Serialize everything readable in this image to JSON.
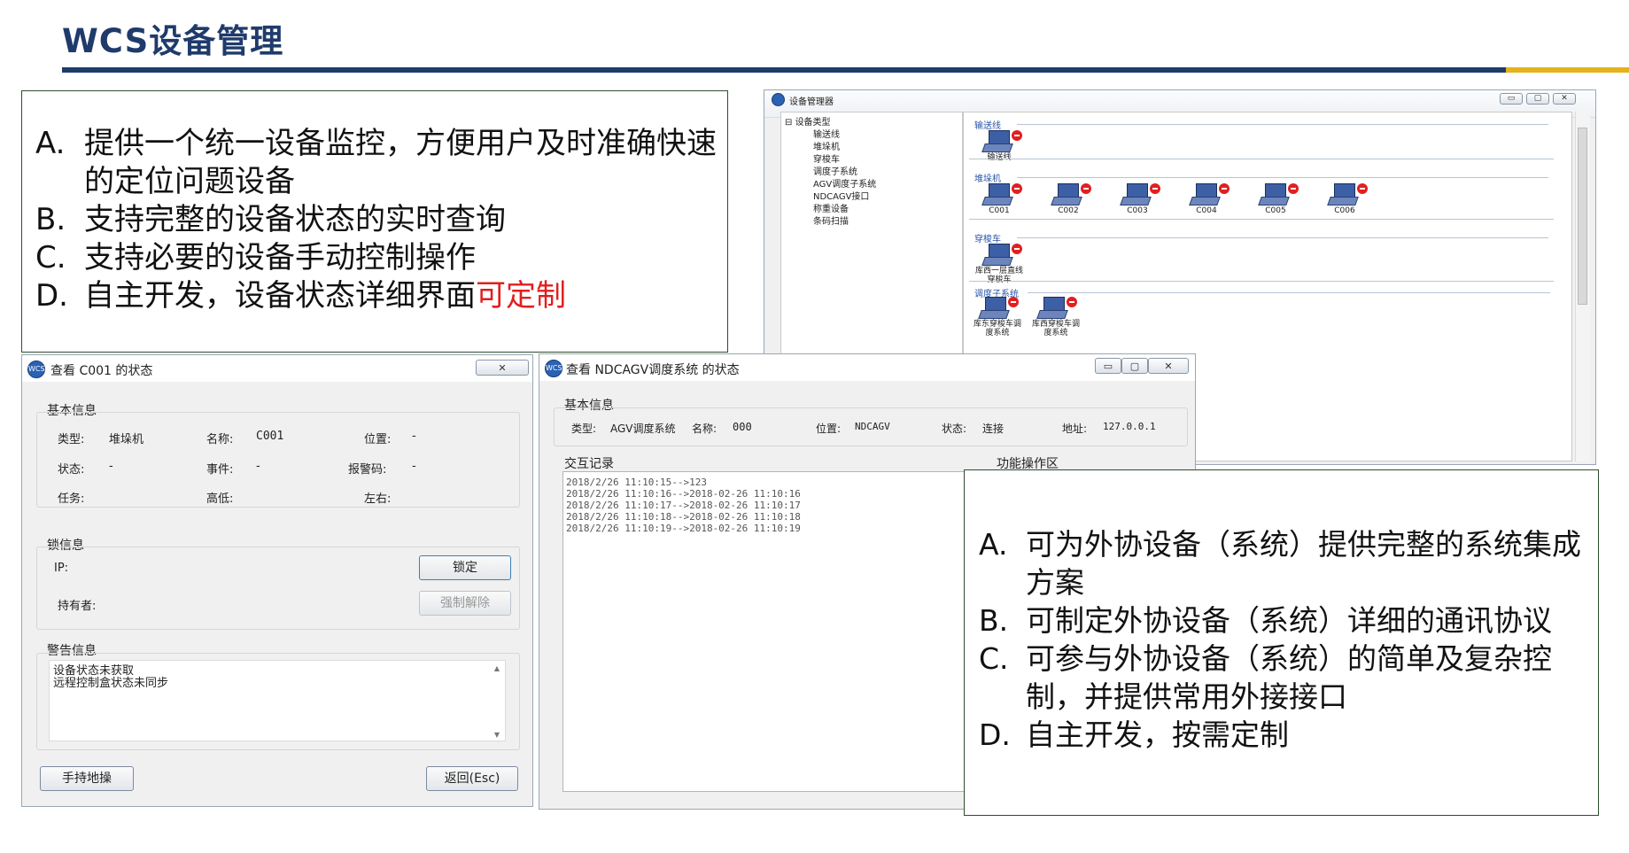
{
  "slide": {
    "title": "WCS设备管理",
    "colors": {
      "title": "#1f3b6b",
      "bar": "#1f3b6b",
      "accent": "#e3b21c",
      "highlight": "#e11e1e"
    }
  },
  "box1": {
    "items": [
      {
        "letter": "A.",
        "text": "提供一个统一设备监控，方便用户及时准确快速的定位问题设备"
      },
      {
        "letter": "B.",
        "text": "支持完整的设备状态的实时查询"
      },
      {
        "letter": "C.",
        "text": "支持必要的设备手动控制操作"
      },
      {
        "letter": "D.",
        "text": "自主开发，设备状态详细界面",
        "highlight": "可定制"
      }
    ]
  },
  "box2": {
    "items": [
      {
        "letter": "A.",
        "text": "可为外协设备（系统）提供完整的系统集成方案"
      },
      {
        "letter": "B.",
        "text": "可制定外协设备（系统）详细的通讯协议"
      },
      {
        "letter": "C.",
        "text": "可参与外协设备（系统）的简单及复杂控制，并提供常用外接接口"
      },
      {
        "letter": "D.",
        "text": "自主开发，按需定制"
      }
    ]
  },
  "devmgr": {
    "title": "设备管理器",
    "tree": {
      "root": "设备类型",
      "items": [
        "输送线",
        "堆垛机",
        "穿梭车",
        "调度子系统",
        "AGV调度子系统",
        "NDCAGV接口",
        "称重设备",
        "条码扫描"
      ]
    },
    "sections": [
      {
        "name": "输送线",
        "devices": [
          "输送线"
        ]
      },
      {
        "name": "堆垛机",
        "devices": [
          "C001",
          "C002",
          "C003",
          "C004",
          "C005",
          "C006"
        ]
      },
      {
        "name": "穿梭车",
        "devices": [
          "库西一层直线穿梭车"
        ]
      },
      {
        "name": "调度子系统",
        "devices": [
          "库东穿梭车调度系统",
          "库西穿梭车调度系统"
        ]
      }
    ]
  },
  "c001": {
    "title": "查看 C001 的状态",
    "basic": {
      "label": "基本信息",
      "type_label": "类型:",
      "type_value": "堆垛机",
      "name_label": "名称:",
      "name_value": "C001",
      "pos_label": "位置:",
      "pos_value": "-",
      "status_label": "状态:",
      "status_value": "-",
      "event_label": "事件:",
      "event_value": "-",
      "alarm_label": "报警码:",
      "alarm_value": "-",
      "task_label": "任务:",
      "height_label": "高低:",
      "lr_label": "左右:"
    },
    "lock": {
      "label": "锁信息",
      "ip_label": "IP:",
      "owner_label": "持有者:",
      "lock_button": "锁定",
      "force_unlock_button": "强制解除"
    },
    "warning": {
      "label": "警告信息",
      "lines": [
        "设备状态未获取",
        "远程控制盒状态未同步"
      ]
    },
    "handheld_button": "手持地操",
    "back_button": "返回(Esc)"
  },
  "agv": {
    "title": "查看 NDCAGV调度系统 的状态",
    "basic": {
      "label": "基本信息",
      "type_label": "类型:",
      "type_value": "AGV调度系统",
      "name_label": "名称:",
      "name_value": "000",
      "pos_label": "位置:",
      "pos_value": "NDCAGV",
      "status_label": "状态:",
      "status_value": "连接",
      "addr_label": "地址:",
      "addr_value": "127.0.0.1"
    },
    "log_label": "交互记录",
    "func_label": "功能操作区",
    "log": [
      "2018/2/26 11:10:15-->123",
      "2018/2/26 11:10:16-->2018-02-26 11:10:16",
      "2018/2/26 11:10:17-->2018-02-26 11:10:17",
      "2018/2/26 11:10:18-->2018-02-26 11:10:18",
      "2018/2/26 11:10:19-->2018-02-26 11:10:19"
    ]
  }
}
